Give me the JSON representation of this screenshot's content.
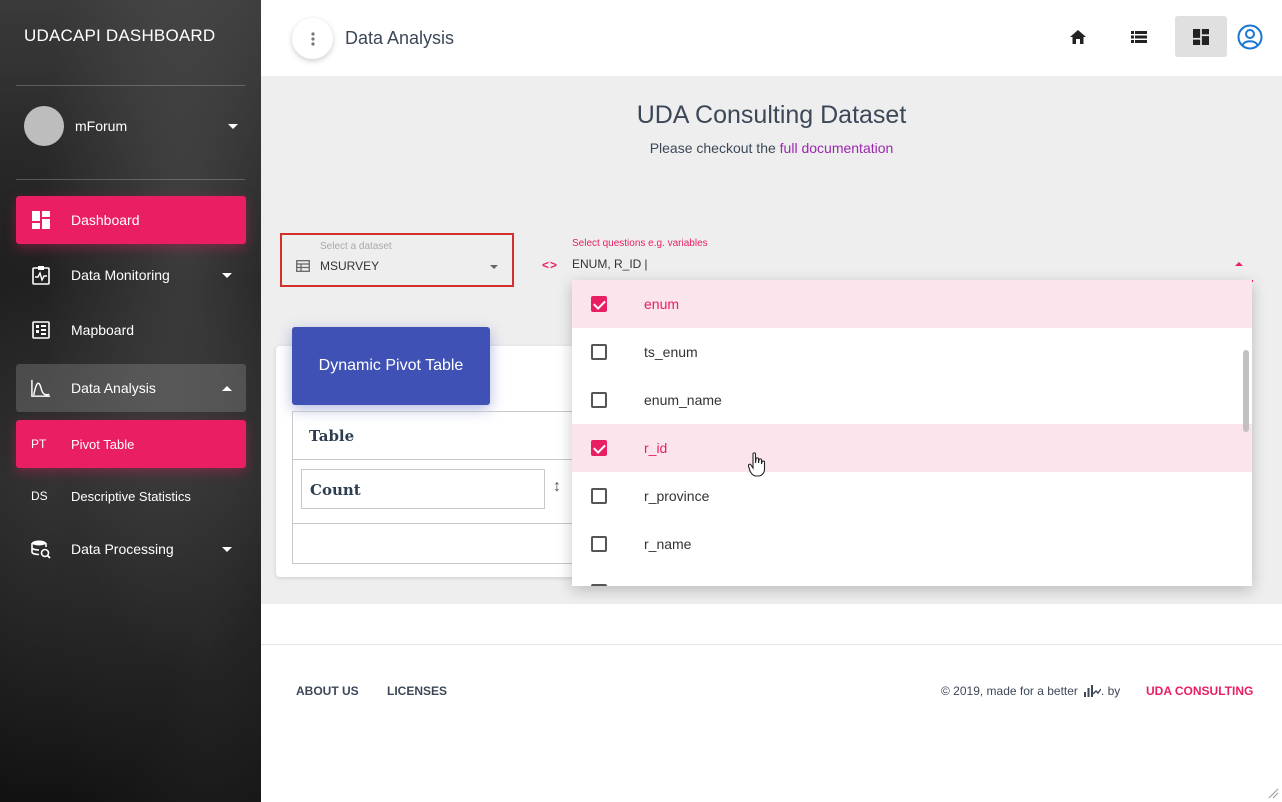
{
  "sidebar": {
    "brand": "UDACAPI DASHBOARD",
    "user": {
      "name": "mForum"
    },
    "items": [
      {
        "label": "Dashboard",
        "icon": "dashboard-icon",
        "active": true
      },
      {
        "label": "Data Monitoring",
        "icon": "monitoring-icon"
      },
      {
        "label": "Mapboard",
        "icon": "mapboard-icon"
      },
      {
        "label": "Data Analysis",
        "icon": "analysis-icon",
        "expanded": true
      },
      {
        "label": "Data Processing",
        "icon": "processing-icon"
      }
    ],
    "subitems": [
      {
        "abbr": "PT",
        "label": "Pivot Table",
        "active": true
      },
      {
        "abbr": "DS",
        "label": "Descriptive Statistics"
      }
    ]
  },
  "topbar": {
    "title": "Data Analysis",
    "icons": [
      "home-icon",
      "list-icon",
      "dashboard-icon",
      "account-icon"
    ]
  },
  "main": {
    "title": "UDA Consulting Dataset",
    "subtitle_prefix": "Please checkout the ",
    "subtitle_link": "full documentation",
    "dataset_select": {
      "label": "Select a dataset",
      "value": "MSURVEY"
    },
    "questions_select": {
      "label": "Select questions e.g. variables",
      "value": "ENUM, R_ID"
    },
    "card_title": "Dynamic Pivot Table",
    "pivot": {
      "renderer": "Table",
      "aggregator": "Count"
    }
  },
  "dropdown": {
    "options": [
      {
        "label": "enum",
        "checked": true
      },
      {
        "label": "ts_enum",
        "checked": false
      },
      {
        "label": "enum_name",
        "checked": false
      },
      {
        "label": "r_id",
        "checked": true
      },
      {
        "label": "r_province",
        "checked": false
      },
      {
        "label": "r_name",
        "checked": false
      }
    ]
  },
  "footer": {
    "about": "ABOUT US",
    "licenses": "LICENSES",
    "copyright_prefix": "© 2019, made for a better",
    "copyright_suffix": ". by",
    "company": "UDA CONSULTING"
  },
  "colors": {
    "accent": "#e91e63",
    "primary": "#3f51b5",
    "link": "#9c27b0"
  }
}
